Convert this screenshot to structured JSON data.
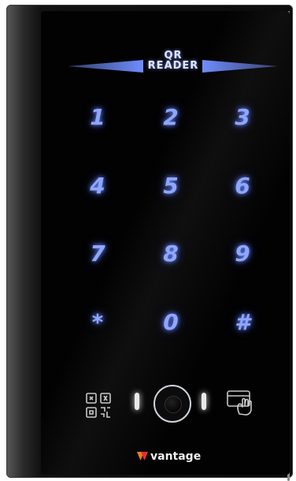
{
  "device": {
    "brand_line1": "QR",
    "brand_line2": "READER",
    "keypad": [
      {
        "key": "1"
      },
      {
        "key": "2"
      },
      {
        "key": "3"
      },
      {
        "key": "4"
      },
      {
        "key": "5"
      },
      {
        "key": "6"
      },
      {
        "key": "7"
      },
      {
        "key": "8"
      },
      {
        "key": "9"
      },
      {
        "key": "*"
      },
      {
        "key": "0"
      },
      {
        "key": "#"
      }
    ],
    "bottom_icons": [
      "qr-code-icon",
      "camera-icon",
      "card-tap-icon"
    ],
    "logo_text": "vantage",
    "colors": {
      "key_glow": "#8fa6ff",
      "wedge": "#6f8dff",
      "panel": "#020203",
      "logo_orange": "#f07a20",
      "logo_red": "#e2322b"
    }
  }
}
